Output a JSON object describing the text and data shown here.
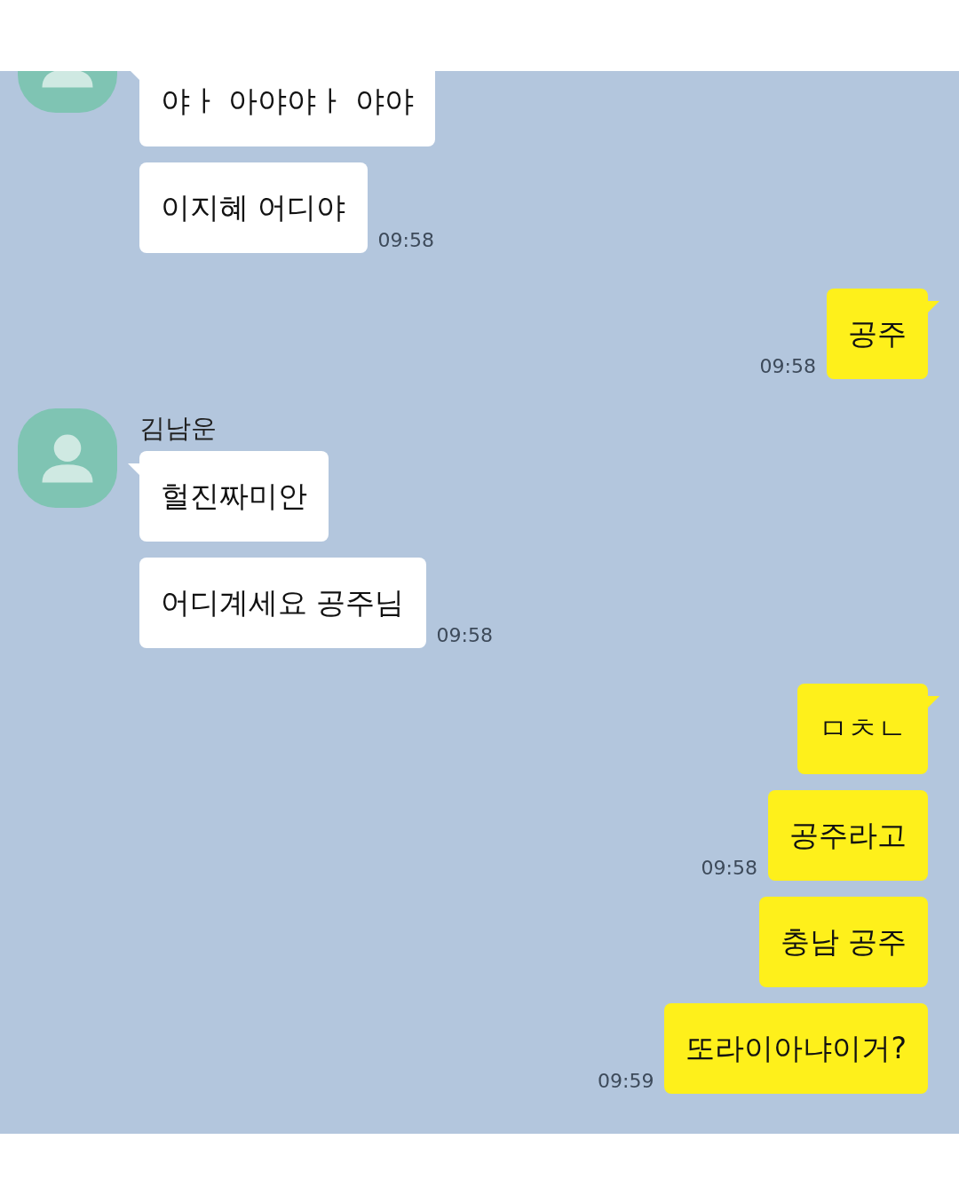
{
  "groups": [
    {
      "kind": "received",
      "bubbles": [
        {
          "text": "야ㅏ 아야야ㅏ 야야"
        },
        {
          "text": "이지혜 어디야",
          "time": "09:58"
        }
      ]
    },
    {
      "kind": "sent",
      "bubbles": [
        {
          "text": "공주",
          "time": "09:58"
        }
      ]
    },
    {
      "kind": "received",
      "sender": "김남운",
      "bubbles": [
        {
          "text": "헐진짜미안"
        },
        {
          "text": "어디계세요 공주님",
          "time": "09:58"
        }
      ]
    },
    {
      "kind": "sent",
      "bubbles": [
        {
          "text": "ㅁㅊㄴ"
        },
        {
          "text": "공주라고",
          "time": "09:58"
        },
        {
          "text": "충남 공주"
        },
        {
          "text": "또라이아냐이거?",
          "time": "09:59"
        }
      ]
    }
  ]
}
